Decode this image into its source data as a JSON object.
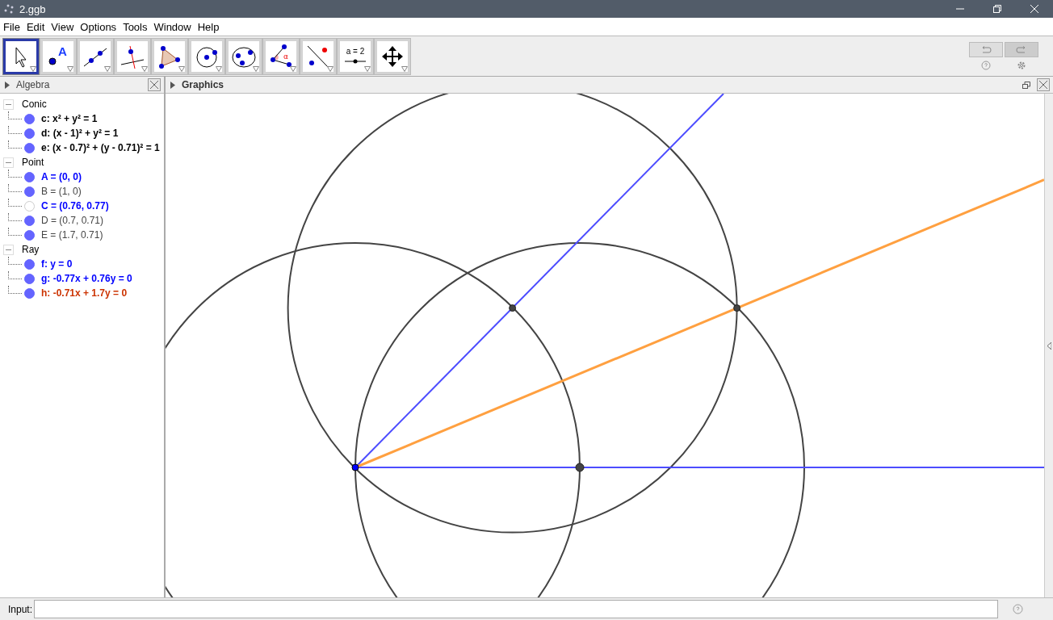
{
  "window": {
    "title": "2.ggb"
  },
  "menu": [
    "File",
    "Edit",
    "View",
    "Options",
    "Tools",
    "Window",
    "Help"
  ],
  "tools": [
    {
      "kind": "move",
      "selected": true
    },
    {
      "kind": "point",
      "selected": false,
      "label": "A"
    },
    {
      "kind": "line",
      "selected": false
    },
    {
      "kind": "perpendicular",
      "selected": false
    },
    {
      "kind": "polygon",
      "selected": false
    },
    {
      "kind": "circle",
      "selected": false
    },
    {
      "kind": "conic",
      "selected": false
    },
    {
      "kind": "angle",
      "selected": false,
      "label": "α"
    },
    {
      "kind": "reflect",
      "selected": false
    },
    {
      "kind": "slider",
      "selected": false,
      "label": "a = 2"
    },
    {
      "kind": "pan",
      "selected": false
    }
  ],
  "algebra": {
    "title": "Algebra",
    "groups": [
      {
        "label": "Conic",
        "expanded": true,
        "items": [
          {
            "text": "c: x² + y² = 1",
            "color": "#000000",
            "bold": true,
            "visible": true
          },
          {
            "text": "d: (x - 1)² + y² = 1",
            "color": "#000000",
            "bold": true,
            "visible": true
          },
          {
            "text": "e: (x - 0.7)² + (y - 0.71)² = 1",
            "color": "#000000",
            "bold": true,
            "visible": true
          }
        ]
      },
      {
        "label": "Point",
        "expanded": true,
        "items": [
          {
            "text": "A = (0, 0)",
            "color": "#0000ff",
            "bold": true,
            "visible": true
          },
          {
            "text": "B = (1, 0)",
            "color": "#444444",
            "bold": false,
            "visible": true
          },
          {
            "text": "C = (0.76, 0.77)",
            "color": "#0000ff",
            "bold": true,
            "visible": false
          },
          {
            "text": "D = (0.7, 0.71)",
            "color": "#444444",
            "bold": false,
            "visible": true
          },
          {
            "text": "E = (1.7, 0.71)",
            "color": "#444444",
            "bold": false,
            "visible": true
          }
        ]
      },
      {
        "label": "Ray",
        "expanded": true,
        "items": [
          {
            "text": "f: y = 0",
            "color": "#0000ff",
            "bold": true,
            "visible": true
          },
          {
            "text": "g: -0.77x + 0.76y = 0",
            "color": "#0000ff",
            "bold": true,
            "visible": true
          },
          {
            "text": "h: -0.71x + 1.7y = 0",
            "color": "#cc3300",
            "bold": true,
            "visible": true
          }
        ]
      }
    ]
  },
  "graphics": {
    "title": "Graphics"
  },
  "input": {
    "label": "Input:"
  }
}
